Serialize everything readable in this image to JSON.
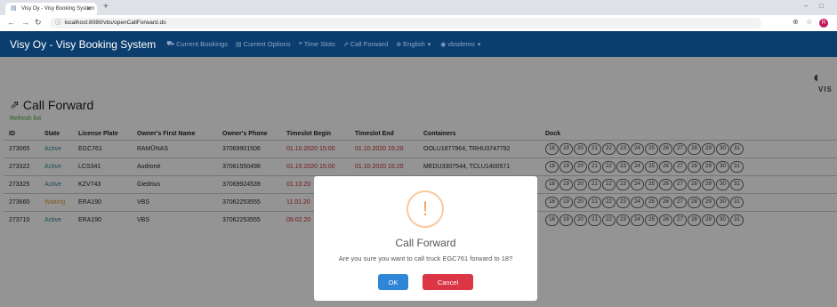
{
  "browser": {
    "tab_title": "Visy Oy - Visy Booking System",
    "url": "localhost:8080/vbs/openCallForward.do",
    "avatar_letter": "R"
  },
  "navbar": {
    "brand": "Visy Oy - Visy Booking System",
    "items": [
      "Current Bookings",
      "Current Options",
      "Time Slots",
      "Call Forward",
      "English",
      "vbsdemo"
    ]
  },
  "logo": {
    "text": "VIS"
  },
  "page": {
    "title": "Call Forward",
    "refresh_label": "Refresh list"
  },
  "table": {
    "headers": [
      "ID",
      "State",
      "License Plate",
      "Owner's First Name",
      "Owner's Phone",
      "Timeslot Begin",
      "Timeslot End",
      "Containers",
      "Dock"
    ],
    "rows": [
      [
        "273065",
        "Active",
        "EGC761",
        "RAMŪNAS",
        "37069901506",
        "01.10.2020 15:00",
        "01.10.2020 15:20",
        "OOLU1877964, TRHU3747792"
      ],
      [
        "273322",
        "Active",
        "LCS341",
        "Audronė",
        "37061550498",
        "01.10.2020 15:00",
        "01.10.2020 15:20",
        "MEDU3307544, TCLU1400571"
      ],
      [
        "273325",
        "Active",
        "KZV743",
        "Giedrius",
        "37069924539",
        "01.10.20",
        "",
        ""
      ],
      [
        "273660",
        "Waiting",
        "ERA190",
        "VBS",
        "37062253555",
        "11.01.20",
        "",
        ""
      ],
      [
        "273710",
        "Active",
        "ERA190",
        "VBS",
        "37062253555",
        "09.02.20",
        "",
        ""
      ]
    ],
    "docks": [
      "18",
      "19",
      "20",
      "21",
      "22",
      "23",
      "24",
      "25",
      "26",
      "27",
      "28",
      "29",
      "30",
      "31"
    ]
  },
  "modal": {
    "icon": "!",
    "title": "Call Forward",
    "message": "Are you sure you want to call truck EGC761 forward to 18?",
    "ok_label": "OK",
    "cancel_label": "Cancel"
  },
  "colors": {
    "navbar": "#0b3d6e",
    "active": "#2a8a99",
    "waiting": "#e0a030",
    "timeslot": "#c62828",
    "ok": "#2f86d6",
    "cancel": "#dc3545"
  }
}
